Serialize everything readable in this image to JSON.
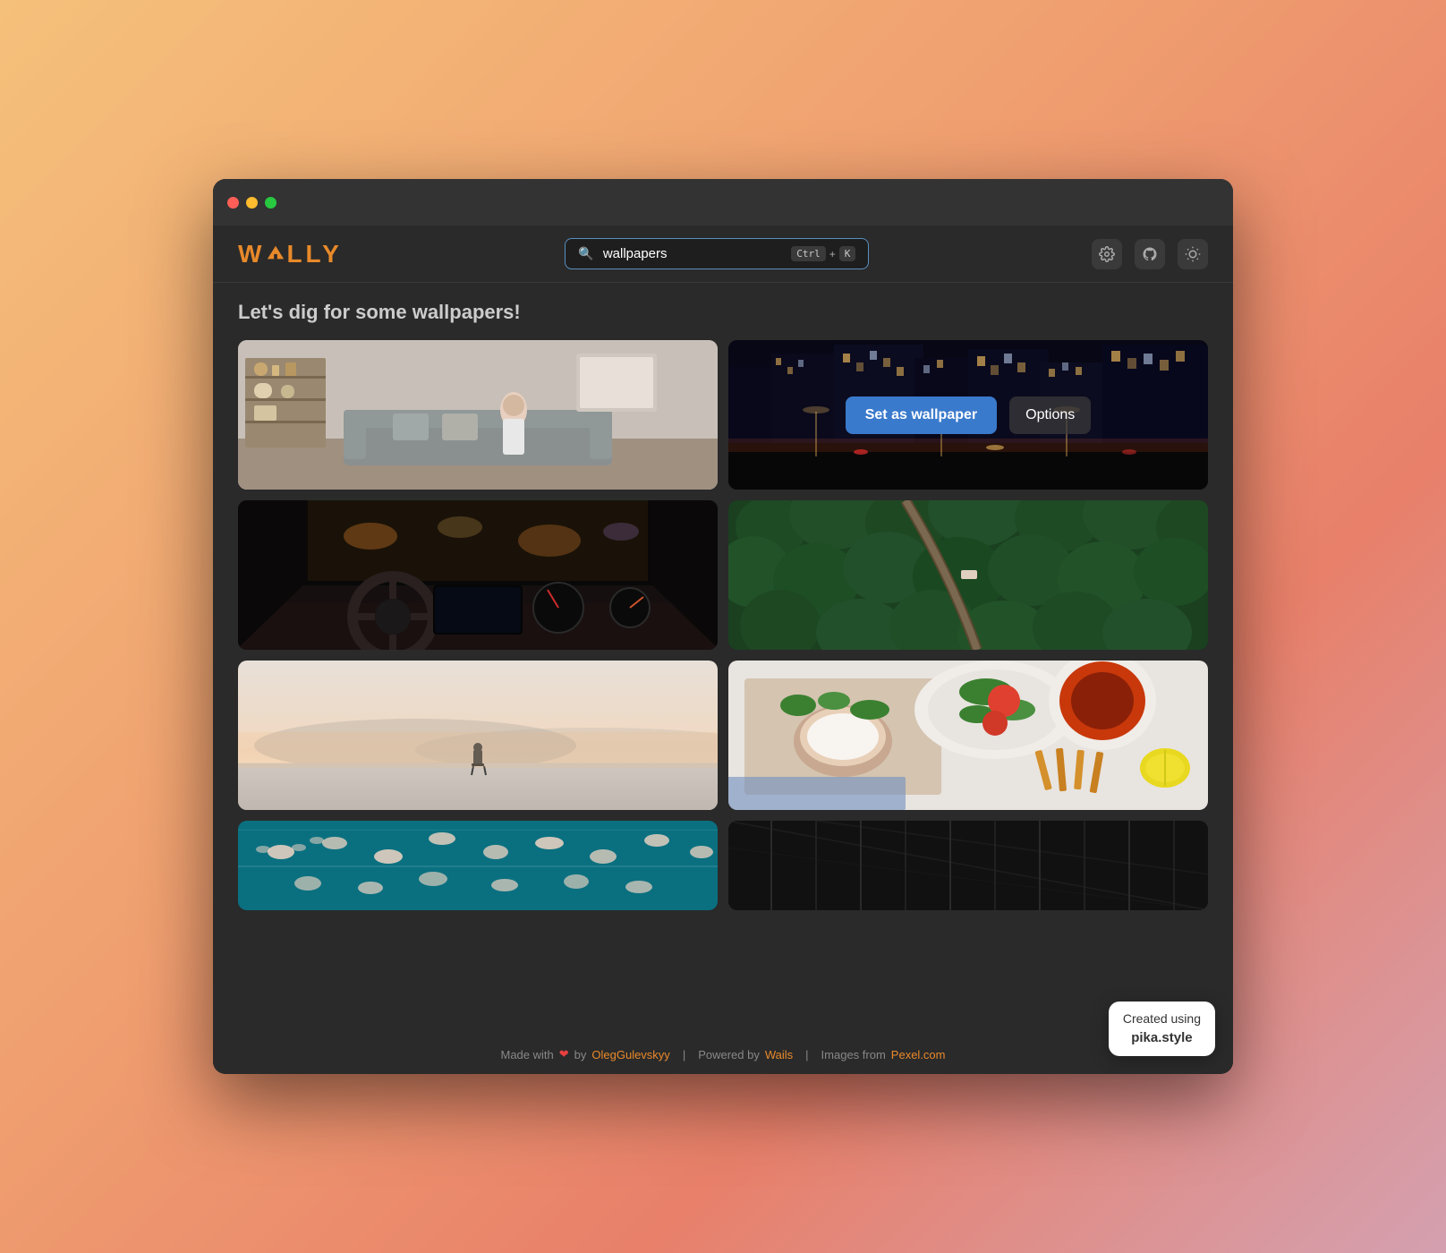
{
  "app": {
    "title": "WALLY",
    "logo_text": "WALLY"
  },
  "header": {
    "search": {
      "value": "wallpapers",
      "placeholder": "wallpapers"
    },
    "shortcut": {
      "ctrl": "Ctrl",
      "plus": "+",
      "key": "K"
    },
    "actions": {
      "settings_label": "⚙",
      "github_label": "⌥",
      "theme_label": "☀"
    }
  },
  "main": {
    "heading": "Let's dig for some wallpapers!",
    "cards": [
      {
        "id": "card-1",
        "type": "interior",
        "alt": "Living room interior"
      },
      {
        "id": "card-2",
        "type": "city",
        "alt": "City at night",
        "hovered": true
      },
      {
        "id": "card-3",
        "type": "car",
        "alt": "Car dashboard interior"
      },
      {
        "id": "card-4",
        "type": "forest",
        "alt": "Aerial forest view"
      },
      {
        "id": "card-5",
        "type": "desert",
        "alt": "Desert landscape with person"
      },
      {
        "id": "card-6",
        "type": "food",
        "alt": "Food flat lay"
      },
      {
        "id": "card-7",
        "type": "pool",
        "alt": "Aerial pool with swimmers"
      },
      {
        "id": "card-8",
        "type": "dark",
        "alt": "Dark abstract"
      }
    ],
    "overlay": {
      "set_wallpaper": "Set as wallpaper",
      "options": "Options"
    }
  },
  "footer": {
    "made_with": "Made with",
    "heart": "❤",
    "by_text": "by",
    "author": "OlegGulevskyy",
    "powered_by": "Powered by",
    "wails": "Wails",
    "images_from": "Images from",
    "pexels": "Pexel.com"
  },
  "pika_badge": {
    "line1": "Created using",
    "line2": "pika.style"
  }
}
